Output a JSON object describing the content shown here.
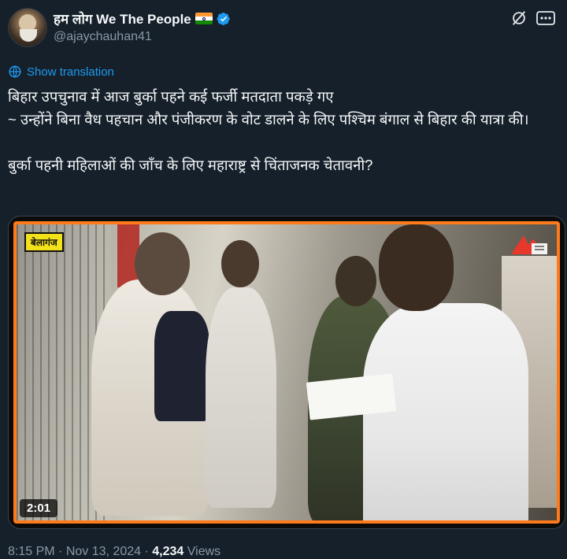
{
  "author": {
    "display_name": "हम लोग We The People",
    "handle": "@ajaychauhan41",
    "verified_color": "#1d9bf0"
  },
  "actions": {
    "grok_icon": "grok-icon",
    "more_icon": "more-icon"
  },
  "translate": {
    "label": "Show translation"
  },
  "tweet": {
    "lines": [
      "बिहार उपचुनाव में आज बुर्का पहने कई फर्जी मतदाता पकड़े गए",
      "~ उन्होंने बिना वैध पहचान और पंजीकरण के वोट डालने के लिए पश्चिम बंगाल से बिहार की यात्रा की।",
      "बुर्का पहनी महिलाओं की जाँच के लिए महाराष्ट्र से चिंताजनक चेतावनी?"
    ]
  },
  "media": {
    "type": "video",
    "watermark": "बेलागंज",
    "duration": "2:01",
    "frame_color": "#ff7a1a"
  },
  "meta": {
    "time": "8:15 PM",
    "separator": "·",
    "date": "Nov 13, 2024",
    "views_count": "4,234",
    "views_label": "Views"
  },
  "colors": {
    "background": "#15202b",
    "text": "#f7f9f9",
    "secondary": "#8b98a5",
    "accent": "#1d9bf0"
  }
}
